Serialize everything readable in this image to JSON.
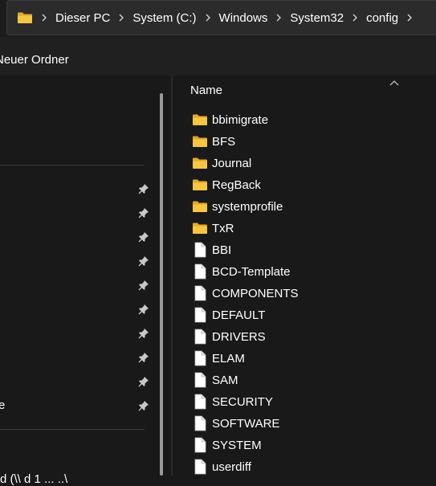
{
  "address_bar": {
    "breadcrumbs": [
      "Dieser PC",
      "System (C:)",
      "Windows",
      "System32",
      "config"
    ]
  },
  "toolbar": {
    "new_folder_label": "Neuer Ordner"
  },
  "nav_pane": {
    "partial_item_label": "e",
    "partial_bottom_text": "d (\\\\ d 1 ... ..\\"
  },
  "content": {
    "column_header": "Name",
    "items": [
      {
        "name": "bbimigrate",
        "type": "folder"
      },
      {
        "name": "BFS",
        "type": "folder"
      },
      {
        "name": "Journal",
        "type": "folder"
      },
      {
        "name": "RegBack",
        "type": "folder"
      },
      {
        "name": "systemprofile",
        "type": "folder"
      },
      {
        "name": "TxR",
        "type": "folder"
      },
      {
        "name": "BBI",
        "type": "file"
      },
      {
        "name": "BCD-Template",
        "type": "file"
      },
      {
        "name": "COMPONENTS",
        "type": "file"
      },
      {
        "name": "DEFAULT",
        "type": "file"
      },
      {
        "name": "DRIVERS",
        "type": "file"
      },
      {
        "name": "ELAM",
        "type": "file"
      },
      {
        "name": "SAM",
        "type": "file"
      },
      {
        "name": "SECURITY",
        "type": "file"
      },
      {
        "name": "SOFTWARE",
        "type": "file"
      },
      {
        "name": "SYSTEM",
        "type": "file"
      },
      {
        "name": "userdiff",
        "type": "file"
      }
    ]
  },
  "colors": {
    "folder": "#f8c542",
    "folder_dark": "#e2a72a",
    "background": "#191919"
  }
}
